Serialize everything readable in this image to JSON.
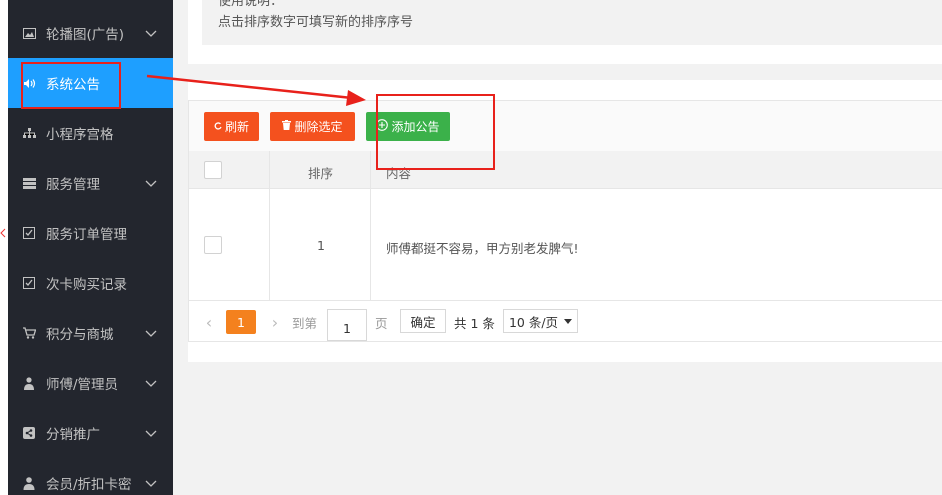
{
  "sidebar": {
    "items": [
      {
        "label": "轮播图(广告)",
        "icon": "image-icon",
        "expandable": true
      },
      {
        "label": "系统公告",
        "icon": "speaker-icon",
        "expandable": false,
        "active": true
      },
      {
        "label": "小程序宫格",
        "icon": "sitemap-icon",
        "expandable": false
      },
      {
        "label": "服务管理",
        "icon": "server-icon",
        "expandable": true
      },
      {
        "label": "服务订单管理",
        "icon": "checkbox-icon",
        "expandable": false
      },
      {
        "label": "次卡购买记录",
        "icon": "checkbox-icon",
        "expandable": false
      },
      {
        "label": "积分与商城",
        "icon": "cart-icon",
        "expandable": true
      },
      {
        "label": "师傅/管理员",
        "icon": "user-tie-icon",
        "expandable": true
      },
      {
        "label": "分销推广",
        "icon": "share-icon",
        "expandable": true
      },
      {
        "label": "会员/折扣卡密",
        "icon": "user-icon",
        "expandable": true
      }
    ]
  },
  "tips": {
    "line1": "使用说明：",
    "line2": "点击排序数字可填写新的排序序号"
  },
  "toolbar": {
    "refresh_label": "刷新",
    "delete_label": "删除选定",
    "add_label": "添加公告"
  },
  "table": {
    "headers": {
      "sort": "排序",
      "content": "内容"
    },
    "rows": [
      {
        "sort": "1",
        "content": "师傅都挺不容易，甲方别老发脾气!"
      }
    ]
  },
  "pager": {
    "prev": "‹",
    "current": "1",
    "next": "›",
    "goto_label": "到第",
    "page_input_value": "1",
    "page_unit": "页",
    "confirm_label": "确定",
    "total_label": "共 1 条",
    "page_size": "10 条/页"
  },
  "colors": {
    "sidebar_bg": "#23262e",
    "active_blue": "#1e9fff",
    "orange": "#f4511e",
    "green": "#3bb14a",
    "pager_current": "#f4811e",
    "annotation_red": "#e8211b"
  }
}
